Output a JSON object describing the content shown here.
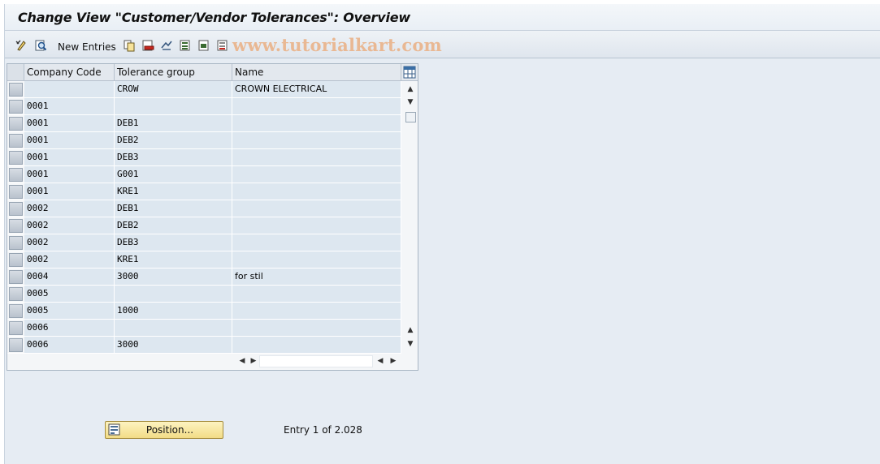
{
  "window": {
    "title": "Change View \"Customer/Vendor Tolerances\": Overview"
  },
  "toolbar": {
    "new_entries_label": "New Entries",
    "watermark": "www.tutorialkart.com",
    "icons": [
      "display-change-icon",
      "details-icon",
      "new-entries",
      "copy-as-icon",
      "delete-icon",
      "undo-change-icon",
      "select-all-icon",
      "select-block-icon",
      "deselect-all-icon"
    ]
  },
  "table": {
    "columns": [
      "Company Code",
      "Tolerance group",
      "Name"
    ],
    "rows": [
      {
        "company_code": "",
        "tolerance_group": "CROW",
        "name": "CROWN ELECTRICAL"
      },
      {
        "company_code": "0001",
        "tolerance_group": "",
        "name": ""
      },
      {
        "company_code": "0001",
        "tolerance_group": "DEB1",
        "name": ""
      },
      {
        "company_code": "0001",
        "tolerance_group": "DEB2",
        "name": ""
      },
      {
        "company_code": "0001",
        "tolerance_group": "DEB3",
        "name": ""
      },
      {
        "company_code": "0001",
        "tolerance_group": "G001",
        "name": ""
      },
      {
        "company_code": "0001",
        "tolerance_group": "KRE1",
        "name": ""
      },
      {
        "company_code": "0002",
        "tolerance_group": "DEB1",
        "name": ""
      },
      {
        "company_code": "0002",
        "tolerance_group": "DEB2",
        "name": ""
      },
      {
        "company_code": "0002",
        "tolerance_group": "DEB3",
        "name": ""
      },
      {
        "company_code": "0002",
        "tolerance_group": "KRE1",
        "name": ""
      },
      {
        "company_code": "0004",
        "tolerance_group": "3000",
        "name": "for stil"
      },
      {
        "company_code": "0005",
        "tolerance_group": "",
        "name": ""
      },
      {
        "company_code": "0005",
        "tolerance_group": "1000",
        "name": ""
      },
      {
        "company_code": "0006",
        "tolerance_group": "",
        "name": ""
      },
      {
        "company_code": "0006",
        "tolerance_group": "3000",
        "name": ""
      }
    ]
  },
  "footer": {
    "position_button_label": "Position...",
    "entry_text": "Entry 1 of 2.028"
  },
  "colors": {
    "background": "#e6ecf3",
    "cell": "#dde7f0",
    "button": "#f2dc86",
    "watermark": "#e9b893"
  }
}
